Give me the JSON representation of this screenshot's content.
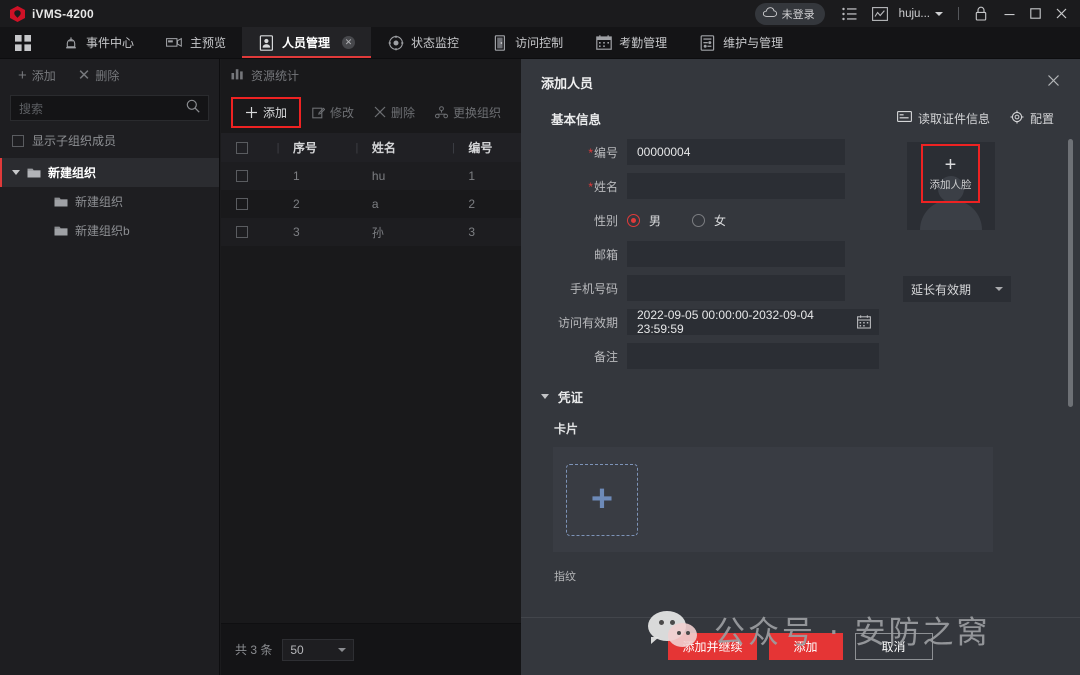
{
  "titlebar": {
    "app_name": "iVMS-4200",
    "logo_icon": "hik-shield-icon",
    "cloud_status": "未登录",
    "cloud_icon": "cloud-icon",
    "list_icon": "list-icon",
    "chart_icon": "chart-icon",
    "user_name": "huju...",
    "lock_icon": "lock-icon",
    "minimize_icon": "minimize-icon",
    "maximize_icon": "maximize-icon",
    "close_icon": "close-icon"
  },
  "navbar": {
    "grid_icon": "apps-grid-icon",
    "items": [
      {
        "label": "事件中心",
        "icon": "alarm-bell-icon",
        "active": false
      },
      {
        "label": "主预览",
        "icon": "camera-icon",
        "active": false
      },
      {
        "label": "人员管理",
        "icon": "person-card-icon",
        "active": true,
        "closable": true
      },
      {
        "label": "状态监控",
        "icon": "target-icon",
        "active": false
      },
      {
        "label": "访问控制",
        "icon": "door-icon",
        "active": false
      },
      {
        "label": "考勤管理",
        "icon": "calendar-icon",
        "active": false
      },
      {
        "label": "维护与管理",
        "icon": "maintenance-icon",
        "active": false
      }
    ]
  },
  "sidebar": {
    "add_label": "添加",
    "delete_label": "删除",
    "search_placeholder": "搜索",
    "search_icon": "search-icon",
    "show_sub_members_label": "显示子组织成员",
    "show_sub_members_checked": false,
    "tree": [
      {
        "label": "新建组织",
        "level": 0,
        "selected": true,
        "expanded": true
      },
      {
        "label": "新建组织",
        "level": 1,
        "selected": false
      },
      {
        "label": "新建组织b",
        "level": 1,
        "selected": false
      }
    ]
  },
  "midpanel": {
    "resource_stat_label": "资源统计",
    "resource_stat_icon": "bar-chart-icon",
    "toolbar": [
      {
        "label": "添加",
        "icon": "plus-icon",
        "highlighted": true
      },
      {
        "label": "修改",
        "icon": "edit-icon",
        "highlighted": false
      },
      {
        "label": "删除",
        "icon": "x-icon",
        "highlighted": false
      },
      {
        "label": "更换组织",
        "icon": "org-change-icon",
        "highlighted": false
      }
    ],
    "columns": [
      "序号",
      "姓名",
      "编号"
    ],
    "rows": [
      {
        "seq": "1",
        "name": "hu",
        "num": "1"
      },
      {
        "seq": "2",
        "name": "a",
        "num": "2"
      },
      {
        "seq": "3",
        "name": "孙",
        "num": "3"
      }
    ],
    "total_label": "共 3 条",
    "page_size": "50"
  },
  "dialog": {
    "title": "添加人员",
    "close_icon": "close-icon",
    "basic_section": {
      "title": "基本信息",
      "read_id_label": "读取证件信息",
      "read_id_icon": "id-card-icon",
      "config_label": "配置",
      "config_icon": "gear-icon"
    },
    "fields": {
      "id_label": "编号",
      "id_value": "00000004",
      "id_required": true,
      "name_label": "姓名",
      "name_value": "",
      "name_required": true,
      "gender_label": "性别",
      "gender_male": "男",
      "gender_female": "女",
      "gender_selected": "男",
      "email_label": "邮箱",
      "email_value": "",
      "phone_label": "手机号码",
      "phone_value": "",
      "validity_label": "访问有效期",
      "validity_value": "2022-09-05 00:00:00-2032-09-04 23:59:59",
      "calendar_icon": "calendar-icon",
      "remark_label": "备注",
      "remark_value": "",
      "extend_validity": "延长有效期"
    },
    "face": {
      "button_label": "添加人脸",
      "plus_icon": "plus-icon",
      "avatar_icon": "person-silhouette-icon"
    },
    "credential_section": {
      "title": "凭证",
      "card_label": "卡片",
      "card_add_icon": "plus-icon",
      "fingerprint_label": "指纹"
    },
    "footer": {
      "add_continue": "添加并继续",
      "add": "添加",
      "cancel": "取消"
    }
  },
  "watermark": {
    "text": "公众号 · 安防之窝",
    "icon": "wechat-icon"
  },
  "colors": {
    "accent_red": "#e53535",
    "highlight_red": "#ee2222",
    "dialog_bg": "#34373d",
    "app_bg": "#1b1b1d",
    "input_bg": "#2b2e34",
    "card_add_blue": "#6d8ab8"
  }
}
